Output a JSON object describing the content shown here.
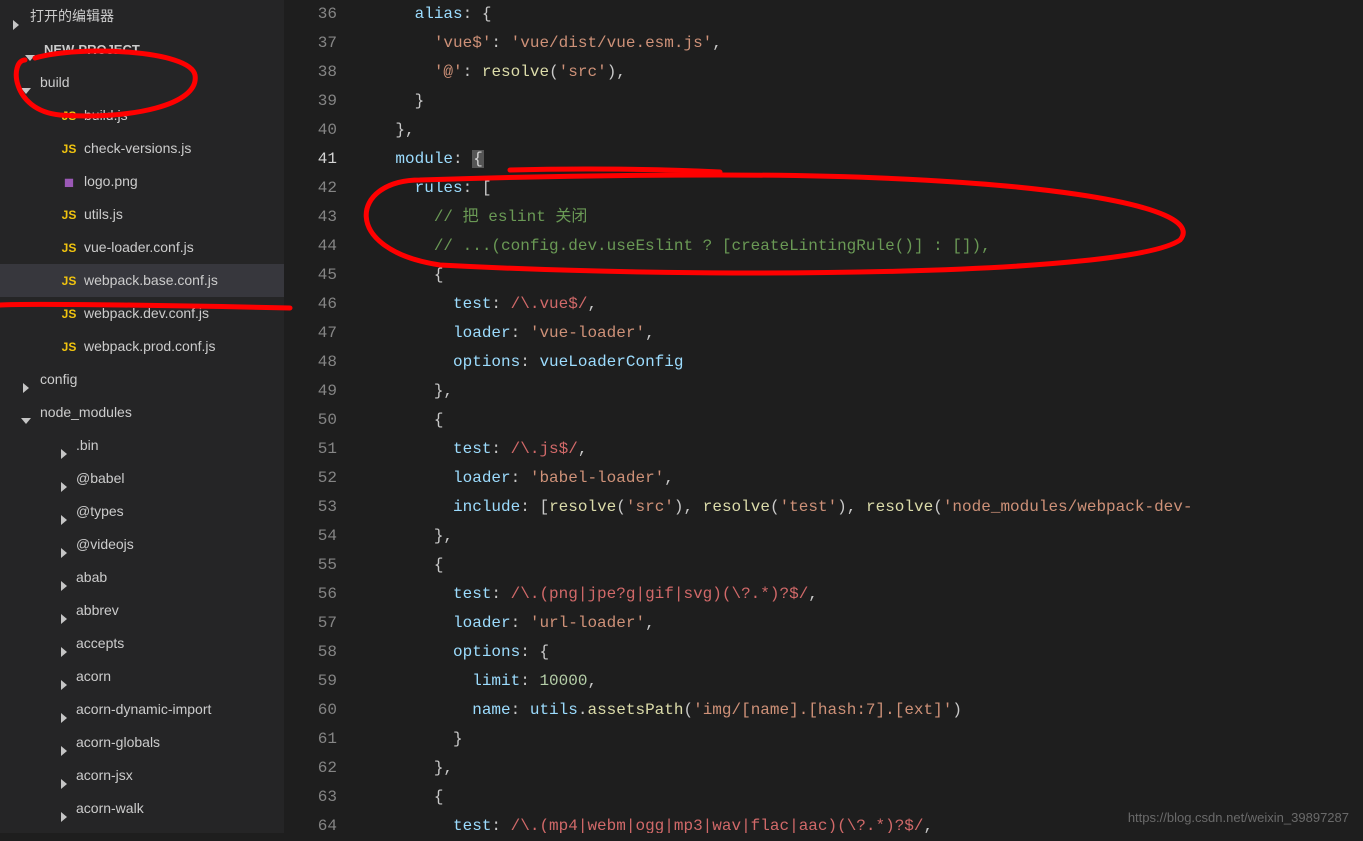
{
  "sidebar": {
    "openEditorsLabel": "打开的编辑器",
    "projectName": "NEW-PROJECT",
    "tree": {
      "build": {
        "label": "build",
        "files": [
          {
            "name": "build.js",
            "icon": "JS"
          },
          {
            "name": "check-versions.js",
            "icon": "JS"
          },
          {
            "name": "logo.png",
            "icon": "◼"
          },
          {
            "name": "utils.js",
            "icon": "JS"
          },
          {
            "name": "vue-loader.conf.js",
            "icon": "JS"
          },
          {
            "name": "webpack.base.conf.js",
            "icon": "JS",
            "selected": true
          },
          {
            "name": "webpack.dev.conf.js",
            "icon": "JS"
          },
          {
            "name": "webpack.prod.conf.js",
            "icon": "JS"
          }
        ]
      },
      "configLabel": "config",
      "nodeModules": {
        "label": "node_modules",
        "folders": [
          ".bin",
          "@babel",
          "@types",
          "@videojs",
          "abab",
          "abbrev",
          "accepts",
          "acorn",
          "acorn-dynamic-import",
          "acorn-globals",
          "acorn-jsx",
          "acorn-walk"
        ]
      }
    }
  },
  "editor": {
    "startLine": 36,
    "lines": [
      {
        "n": 36,
        "html": "      <span class='tk-key'>alias</span><span class='tk-pun'>:</span> <span class='tk-pun'>{</span>"
      },
      {
        "n": 37,
        "html": "        <span class='tk-str'>'vue$'</span><span class='tk-pun'>:</span> <span class='tk-str'>'vue/dist/vue.esm.js'</span><span class='tk-pun'>,</span>"
      },
      {
        "n": 38,
        "html": "        <span class='tk-str'>'@'</span><span class='tk-pun'>:</span> <span class='tk-fun'>resolve</span><span class='tk-pun'>(</span><span class='tk-str'>'src'</span><span class='tk-pun'>)</span><span class='tk-pun'>,</span>"
      },
      {
        "n": 39,
        "html": "      <span class='tk-pun'>}</span>"
      },
      {
        "n": 40,
        "html": "    <span class='tk-pun'>}</span><span class='tk-pun'>,</span>"
      },
      {
        "n": 41,
        "html": "    <span class='tk-key'>module</span><span class='tk-pun'>:</span> <span class='tk-cur'>{</span>",
        "active": true
      },
      {
        "n": 42,
        "html": "      <span class='tk-key'>rules</span><span class='tk-pun'>:</span> <span class='tk-pun'>[</span>"
      },
      {
        "n": 43,
        "html": "        <span class='tk-com'>// 把 eslint 关闭</span>"
      },
      {
        "n": 44,
        "html": "        <span class='tk-com'>// ...(config.dev.useEslint ? [createLintingRule()] : []),</span>"
      },
      {
        "n": 45,
        "html": "        <span class='tk-pun'>{</span>"
      },
      {
        "n": 46,
        "html": "          <span class='tk-key'>test</span><span class='tk-pun'>:</span> <span class='tk-reg'>/\\.vue$/</span><span class='tk-pun'>,</span>"
      },
      {
        "n": 47,
        "html": "          <span class='tk-key'>loader</span><span class='tk-pun'>:</span> <span class='tk-str'>'vue-loader'</span><span class='tk-pun'>,</span>"
      },
      {
        "n": 48,
        "html": "          <span class='tk-key'>options</span><span class='tk-pun'>:</span> <span class='tk-obj'>vueLoaderConfig</span>"
      },
      {
        "n": 49,
        "html": "        <span class='tk-pun'>}</span><span class='tk-pun'>,</span>"
      },
      {
        "n": 50,
        "html": "        <span class='tk-pun'>{</span>"
      },
      {
        "n": 51,
        "html": "          <span class='tk-key'>test</span><span class='tk-pun'>:</span> <span class='tk-reg'>/\\.js$/</span><span class='tk-pun'>,</span>"
      },
      {
        "n": 52,
        "html": "          <span class='tk-key'>loader</span><span class='tk-pun'>:</span> <span class='tk-str'>'babel-loader'</span><span class='tk-pun'>,</span>"
      },
      {
        "n": 53,
        "html": "          <span class='tk-key'>include</span><span class='tk-pun'>:</span> <span class='tk-pun'>[</span><span class='tk-fun'>resolve</span><span class='tk-pun'>(</span><span class='tk-str'>'src'</span><span class='tk-pun'>)</span><span class='tk-pun'>,</span> <span class='tk-fun'>resolve</span><span class='tk-pun'>(</span><span class='tk-str'>'test'</span><span class='tk-pun'>)</span><span class='tk-pun'>,</span> <span class='tk-fun'>resolve</span><span class='tk-pun'>(</span><span class='tk-str'>'node_modules/webpack-dev-</span>"
      },
      {
        "n": 54,
        "html": "        <span class='tk-pun'>}</span><span class='tk-pun'>,</span>"
      },
      {
        "n": 55,
        "html": "        <span class='tk-pun'>{</span>"
      },
      {
        "n": 56,
        "html": "          <span class='tk-key'>test</span><span class='tk-pun'>:</span> <span class='tk-reg'>/\\.(png|jpe?g|gif|svg)(\\?.*)?$/</span><span class='tk-pun'>,</span>"
      },
      {
        "n": 57,
        "html": "          <span class='tk-key'>loader</span><span class='tk-pun'>:</span> <span class='tk-str'>'url-loader'</span><span class='tk-pun'>,</span>"
      },
      {
        "n": 58,
        "html": "          <span class='tk-key'>options</span><span class='tk-pun'>:</span> <span class='tk-pun'>{</span>"
      },
      {
        "n": 59,
        "html": "            <span class='tk-key'>limit</span><span class='tk-pun'>:</span> <span class='tk-num'>10000</span><span class='tk-pun'>,</span>"
      },
      {
        "n": 60,
        "html": "            <span class='tk-key'>name</span><span class='tk-pun'>:</span> <span class='tk-obj'>utils</span><span class='tk-pun'>.</span><span class='tk-fun'>assetsPath</span><span class='tk-pun'>(</span><span class='tk-str'>'img/[name].[hash:7].[ext]'</span><span class='tk-pun'>)</span>"
      },
      {
        "n": 61,
        "html": "          <span class='tk-pun'>}</span>"
      },
      {
        "n": 62,
        "html": "        <span class='tk-pun'>}</span><span class='tk-pun'>,</span>"
      },
      {
        "n": 63,
        "html": "        <span class='tk-pun'>{</span>"
      },
      {
        "n": 64,
        "html": "          <span class='tk-key'>test</span><span class='tk-pun'>:</span> <span class='tk-reg'>/\\.(mp4|webm|ogg|mp3|wav|flac|aac)(\\?.*)?$/</span><span class='tk-pun'>,</span>"
      }
    ]
  },
  "watermark": "https://blog.csdn.net/weixin_39897287"
}
